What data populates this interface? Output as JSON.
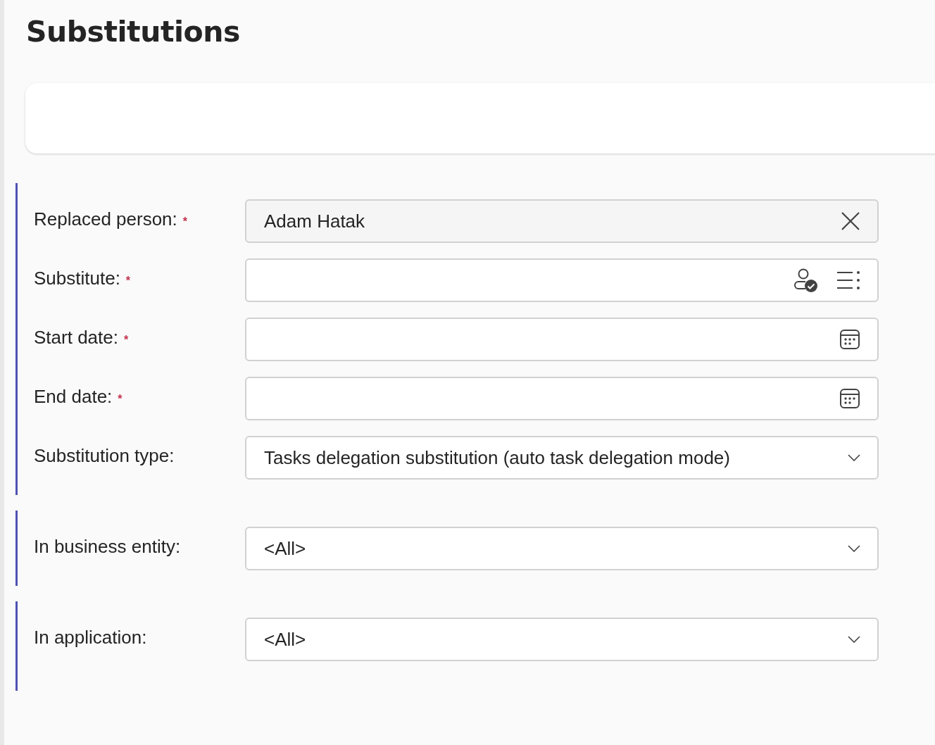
{
  "page": {
    "title": "Substitutions"
  },
  "sections": [
    {
      "fields": [
        {
          "label": "Replaced person:",
          "required_mark": "*",
          "kind": "person",
          "value": "Adam Hatak"
        },
        {
          "label": "Substitute:",
          "required_mark": "*",
          "kind": "picker"
        },
        {
          "label": "Start date:",
          "required_mark": "*",
          "kind": "date"
        },
        {
          "label": "End date:",
          "required_mark": "*",
          "kind": "date"
        },
        {
          "label": "Substitution type:",
          "kind": "select",
          "value": "Tasks delegation substitution (auto task delegation mode)"
        }
      ]
    },
    {
      "fields": [
        {
          "label": "In business entity:",
          "kind": "select",
          "value": "<All>"
        }
      ]
    },
    {
      "fields": [
        {
          "label": "In application:",
          "kind": "select",
          "value": "<All>"
        }
      ]
    }
  ]
}
